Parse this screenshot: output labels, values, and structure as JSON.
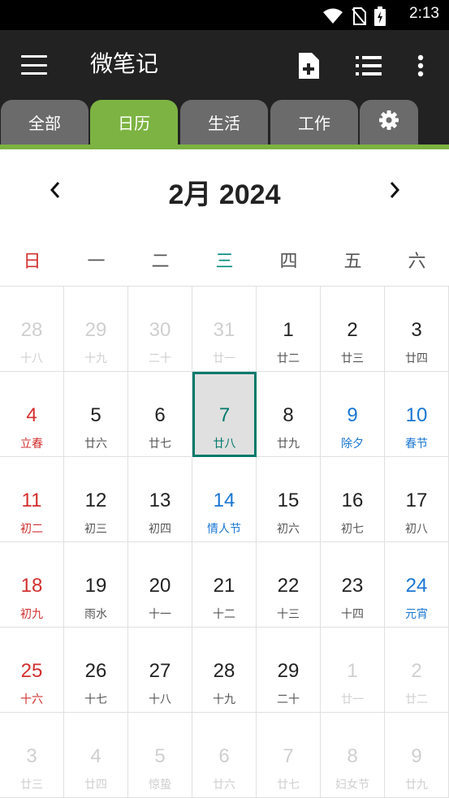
{
  "status_bar": {
    "time": "2:13",
    "icons": [
      "wifi-icon",
      "no-sim-icon",
      "battery-charging-icon"
    ]
  },
  "app_bar": {
    "title": "微笔记",
    "actions": [
      "menu-icon",
      "new-note-icon",
      "list-view-icon",
      "more-vert-icon"
    ]
  },
  "tabs": [
    {
      "label": "全部",
      "active": false
    },
    {
      "label": "日历",
      "active": true
    },
    {
      "label": "生活",
      "active": false
    },
    {
      "label": "工作",
      "active": false
    }
  ],
  "settings_tab_icon": "gear-icon",
  "calendar": {
    "month_title": "2月 2024",
    "prev_icon": "chevron-left-icon",
    "next_icon": "chevron-right-icon",
    "weekdays": [
      "日",
      "一",
      "二",
      "三",
      "四",
      "五",
      "六"
    ],
    "today_weekday_index": 3,
    "weeks": [
      [
        {
          "day": "28",
          "lunar": "十八",
          "outside": true
        },
        {
          "day": "29",
          "lunar": "十九",
          "outside": true
        },
        {
          "day": "30",
          "lunar": "二十",
          "outside": true
        },
        {
          "day": "31",
          "lunar": "廿一",
          "outside": true
        },
        {
          "day": "1",
          "lunar": "廿二"
        },
        {
          "day": "2",
          "lunar": "廿三"
        },
        {
          "day": "3",
          "lunar": "廿四"
        }
      ],
      [
        {
          "day": "4",
          "lunar": "立春",
          "sunday": true
        },
        {
          "day": "5",
          "lunar": "廿六"
        },
        {
          "day": "6",
          "lunar": "廿七"
        },
        {
          "day": "7",
          "lunar": "廿八",
          "selected": true
        },
        {
          "day": "8",
          "lunar": "廿九"
        },
        {
          "day": "9",
          "lunar": "除夕",
          "festival": true
        },
        {
          "day": "10",
          "lunar": "春节",
          "festival": true
        }
      ],
      [
        {
          "day": "11",
          "lunar": "初二",
          "sunday": true
        },
        {
          "day": "12",
          "lunar": "初三"
        },
        {
          "day": "13",
          "lunar": "初四"
        },
        {
          "day": "14",
          "lunar": "情人节",
          "festival": true
        },
        {
          "day": "15",
          "lunar": "初六"
        },
        {
          "day": "16",
          "lunar": "初七"
        },
        {
          "day": "17",
          "lunar": "初八"
        }
      ],
      [
        {
          "day": "18",
          "lunar": "初九",
          "sunday": true
        },
        {
          "day": "19",
          "lunar": "雨水"
        },
        {
          "day": "20",
          "lunar": "十一"
        },
        {
          "day": "21",
          "lunar": "十二"
        },
        {
          "day": "22",
          "lunar": "十三"
        },
        {
          "day": "23",
          "lunar": "十四"
        },
        {
          "day": "24",
          "lunar": "元宵",
          "festival": true
        }
      ],
      [
        {
          "day": "25",
          "lunar": "十六",
          "sunday": true
        },
        {
          "day": "26",
          "lunar": "十七"
        },
        {
          "day": "27",
          "lunar": "十八"
        },
        {
          "day": "28",
          "lunar": "十九"
        },
        {
          "day": "29",
          "lunar": "二十"
        },
        {
          "day": "1",
          "lunar": "廿一",
          "outside": true
        },
        {
          "day": "2",
          "lunar": "廿二",
          "outside": true
        }
      ],
      [
        {
          "day": "3",
          "lunar": "廿三",
          "outside": true
        },
        {
          "day": "4",
          "lunar": "廿四",
          "outside": true
        },
        {
          "day": "5",
          "lunar": "惊蛰",
          "outside": true
        },
        {
          "day": "6",
          "lunar": "廿六",
          "outside": true
        },
        {
          "day": "7",
          "lunar": "廿七",
          "outside": true
        },
        {
          "day": "8",
          "lunar": "妇女节",
          "outside": true
        },
        {
          "day": "9",
          "lunar": "廿九",
          "outside": true
        }
      ]
    ]
  },
  "colors": {
    "accent_green": "#7cb342",
    "today_teal": "#00796b",
    "sunday_red": "#d32f2f",
    "festival_blue": "#1976d2",
    "app_bar": "#222222"
  }
}
